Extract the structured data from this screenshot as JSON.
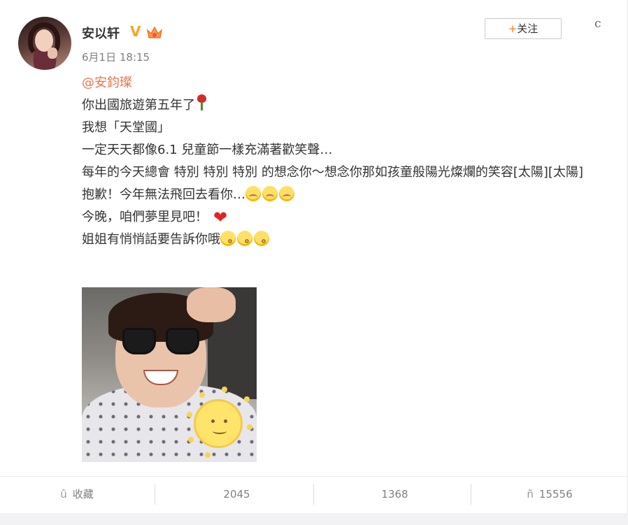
{
  "post": {
    "author": "安以轩",
    "vip_badge": "V",
    "timestamp": "6月1日 18:15",
    "follow_plus": "+",
    "follow_label": "关注",
    "more_glyph": "c",
    "mention": "@安鈞璨",
    "lines": [
      "你出國旅遊第五年了",
      "我想「天堂國」",
      "一定天天都像6.1 兒童節一樣充滿著歡笑聲…",
      "每年的今天總會 特別 特別 特別 的想念你～想念你那如孩童般陽光燦爛的笑容[太陽][太陽]",
      "抱歉！今年無法飛回去看你…",
      "今晚，咱們夢里見吧！",
      "姐姐有悄悄話要告訴你哦"
    ],
    "icons": {
      "rose": "rose-icon",
      "sad": "sad-emoji-icon",
      "heart": "heart-icon",
      "think": "thinking-emoji-icon"
    }
  },
  "actions": {
    "collect": {
      "glyph": "û",
      "label": "收藏"
    },
    "share": {
      "glyph": "",
      "count": "2045"
    },
    "comment": {
      "glyph": "",
      "count": "1368"
    },
    "like": {
      "glyph": "ñ",
      "count": "15556"
    }
  },
  "colors": {
    "mention": "#eb7350",
    "follow_plus": "#ff8200",
    "meta_text": "#808080"
  }
}
